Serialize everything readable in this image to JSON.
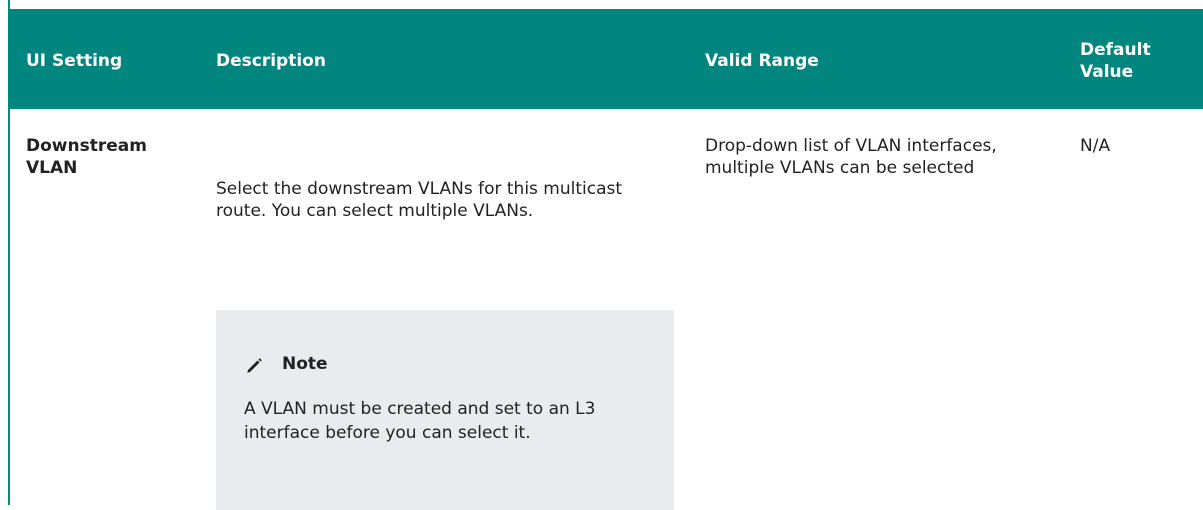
{
  "table": {
    "headers": {
      "ui_setting": "UI Setting",
      "description": "Description",
      "valid_range": "Valid Range",
      "default_value": "Default Value"
    },
    "row": {
      "ui_setting": "Downstream VLAN",
      "description": "Select the downstream VLANs for this multicast route. You can select multiple VLANs.",
      "valid_range": "Drop-down list of VLAN interfaces, multiple VLANs can be selected",
      "default_value": "N/A"
    }
  },
  "note": {
    "icon": "pencil-icon",
    "title": "Note",
    "text": "A VLAN must be created and set to an L3 interface before you can select it."
  },
  "colors": {
    "header_bg": "#00857f",
    "header_text": "#ffffff",
    "note_bg": "#e9ebec"
  }
}
